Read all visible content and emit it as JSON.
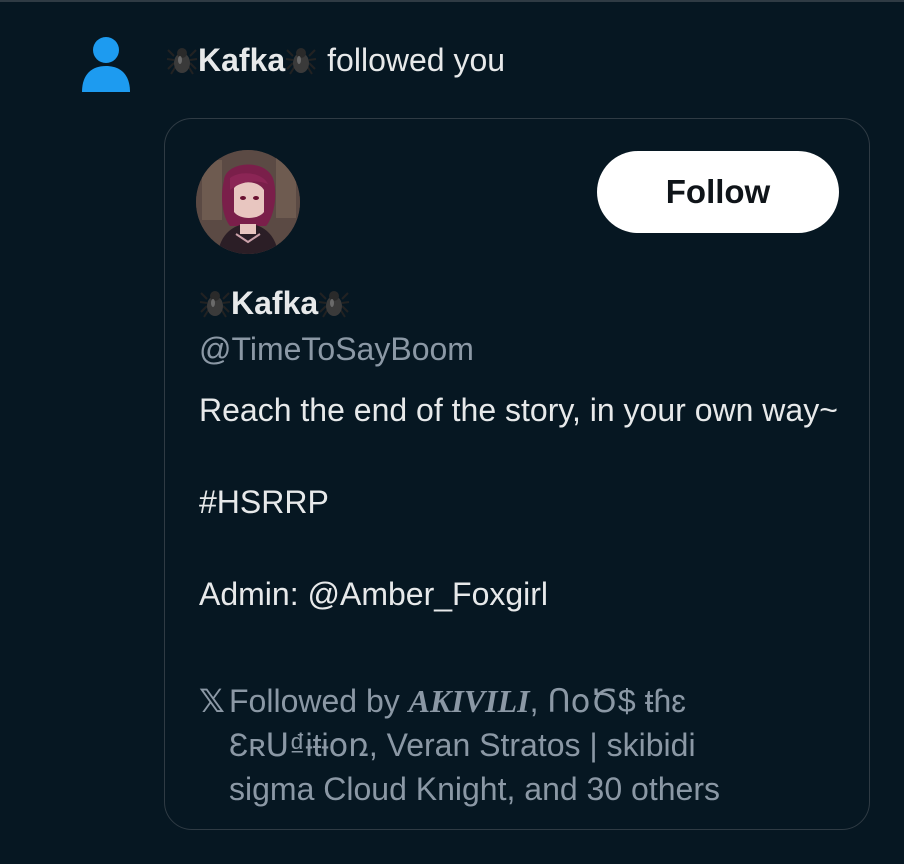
{
  "notification": {
    "name": "Kafka",
    "action": "followed you"
  },
  "card": {
    "follow_label": "Follow",
    "display_name": "Kafka",
    "handle": "@TimeToSayBoom",
    "bio_line1": "Reach the end of the story, in your own way~",
    "bio_hashtag": "#HSRRP",
    "bio_admin": "Admin: @Amber_Foxgirl",
    "followed_by_x": "𝕏",
    "followed_by_prefix": "Followed by ",
    "followed_by_name1": "AKIVILI",
    "followed_by_rest_line1": ", ՈօԾ$ ŧɦɛ",
    "followed_by_line2": "ƐʀՍ₫ɨŧɨօռ, Veran Stratos | skibidi",
    "followed_by_line3": "sigma Cloud Knight, and 30 others"
  },
  "icons": {
    "person": "person-icon",
    "spider": "spider-emoji",
    "x_logo": "x-logo-icon"
  },
  "colors": {
    "background": "#061722",
    "accent_blue": "#1d9bf0",
    "secondary_text": "#8b98a5"
  }
}
